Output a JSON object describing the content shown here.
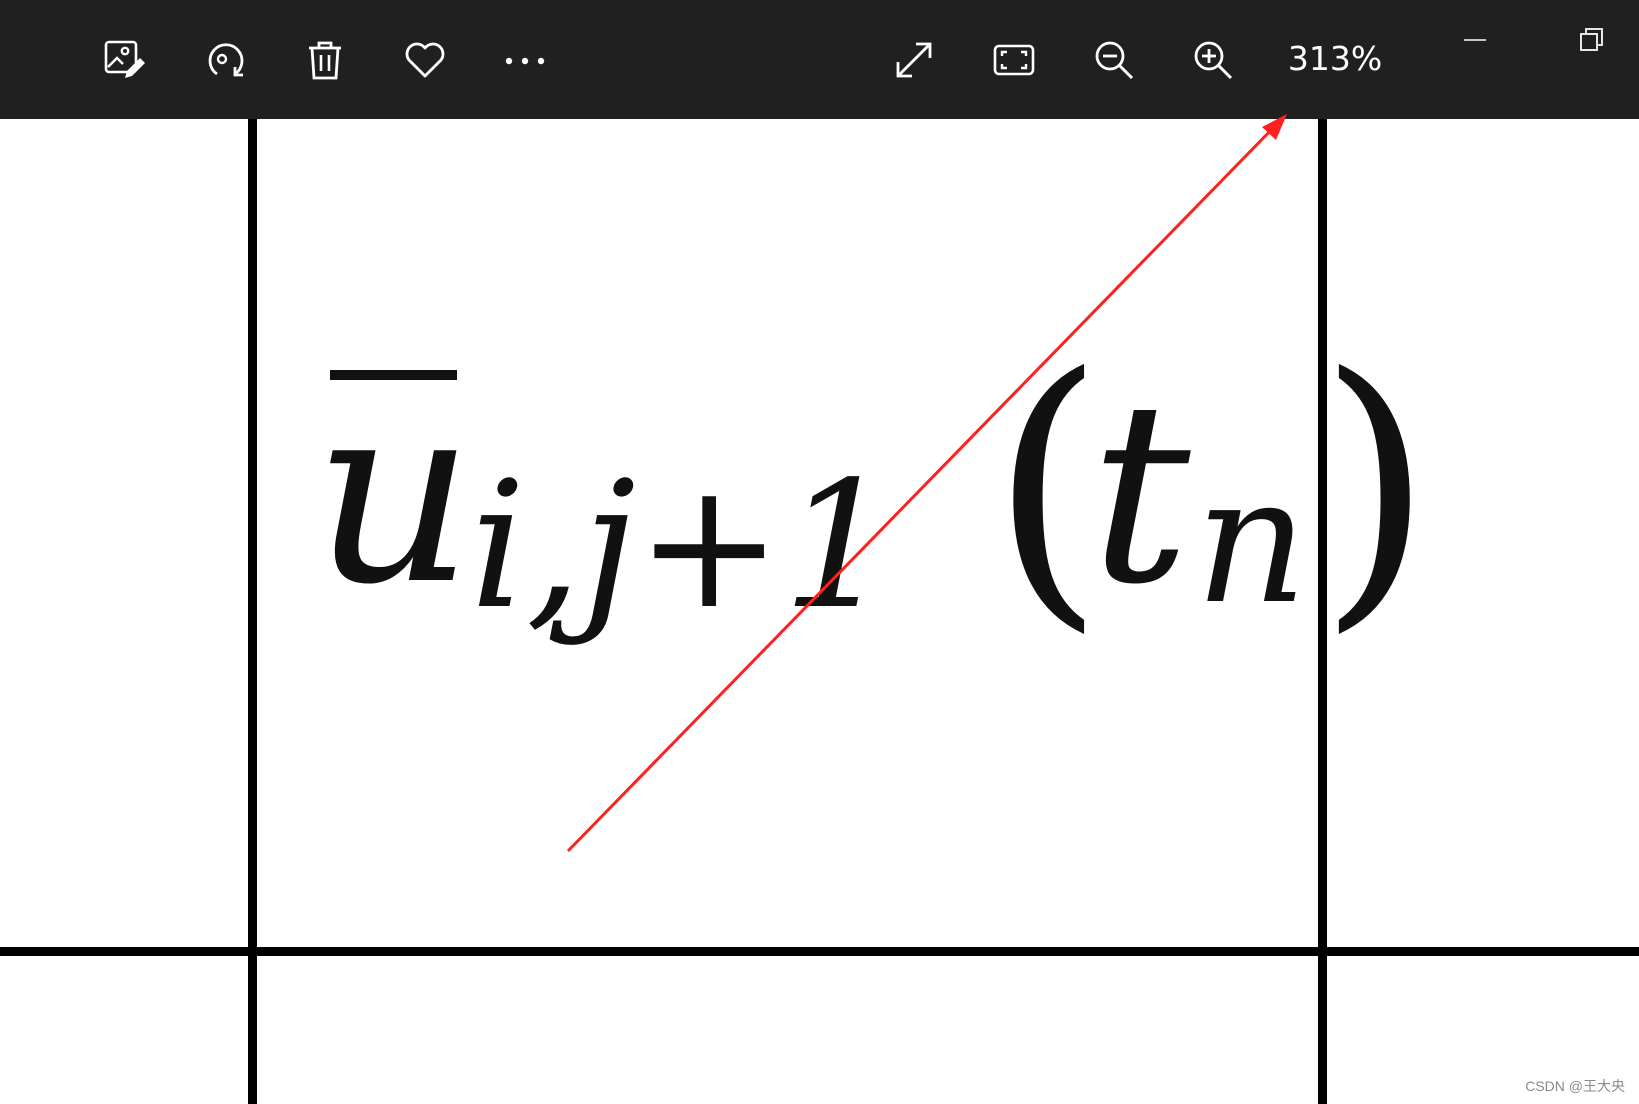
{
  "toolbar": {
    "edit_icon": "edit-image-icon",
    "rotate_icon": "rotate-icon",
    "delete_icon": "delete-icon",
    "favorite_icon": "heart-icon",
    "more_icon": "more-icon",
    "expand_icon": "expand-icon",
    "fit_icon": "fit-to-window-icon",
    "zoom_out_icon": "zoom-out-icon",
    "zoom_in_icon": "zoom-in-icon",
    "zoom_level": "313%"
  },
  "window_controls": {
    "minimize_icon": "minimize-icon",
    "restore_icon": "restore-icon"
  },
  "formula": {
    "base": "u",
    "subscript": "i,j+1",
    "open_paren": "(",
    "argument": "t",
    "argument_subscript": "n",
    "close_paren": ")"
  },
  "annotation": {
    "arrow_color": "#ff2020"
  },
  "colors": {
    "toolbar_bg": "#202020",
    "icon_color": "#ffffff",
    "canvas_bg": "#ffffff"
  },
  "watermark": "CSDN @王大央"
}
